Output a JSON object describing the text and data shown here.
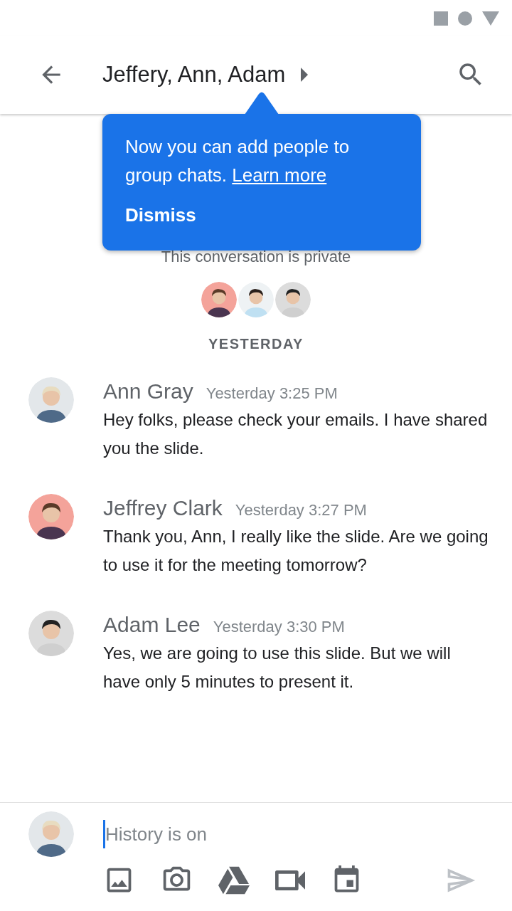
{
  "header": {
    "title": "Jeffery, Ann, Adam"
  },
  "tooltip": {
    "text": "Now you can add people to group chats.",
    "link": "Learn more",
    "action": "Dismiss"
  },
  "notice": "This conversation is private",
  "date_divider": "YESTERDAY",
  "messages": [
    {
      "name": "Ann Gray",
      "time": "Yesterday 3:25 PM",
      "text": "Hey folks, please check your emails. I have shared you the slide."
    },
    {
      "name": "Jeffrey Clark",
      "time": "Yesterday 3:27 PM",
      "text": "Thank you, Ann, I really like the slide. Are we going to use it for the meeting tomorrow?"
    },
    {
      "name": "Adam Lee",
      "time": "Yesterday 3:30 PM",
      "text": "Yes, we are going to use this slide. But we will have only 5 minutes to present it."
    }
  ],
  "composer": {
    "placeholder": "History is on",
    "send_disabled": true
  }
}
